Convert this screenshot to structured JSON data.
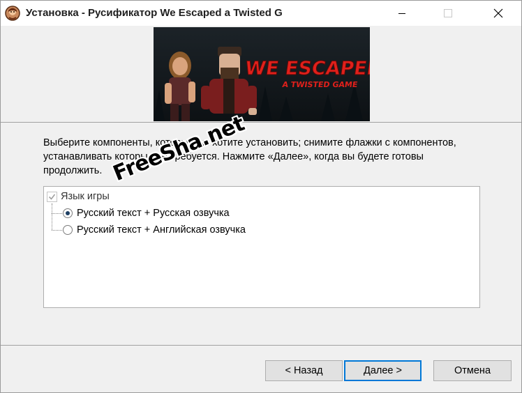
{
  "window": {
    "title": "Установка - Русификатор We Escaped a Twisted G"
  },
  "banner": {
    "headline": "WE ESCAPED",
    "subline": "A TWISTED GAME"
  },
  "description": "Выберите компоненты, которые вы хотите установить; снимите флажки с компонентов, устанавливать которые не требуется. Нажмите «Далее», когда вы будете готовы продолжить.",
  "watermark": "FreeSha.net",
  "components": {
    "group_label": "Язык игры",
    "group_checked": true,
    "options": [
      {
        "label": "Русский текст + Русская озвучка",
        "selected": true
      },
      {
        "label": "Русский текст + Английская озвучка",
        "selected": false
      }
    ]
  },
  "buttons": {
    "back": "< Назад",
    "next": "Далее >",
    "cancel": "Отмена"
  },
  "colors": {
    "accent": "#0078d7",
    "banner_title": "#e0201b"
  }
}
